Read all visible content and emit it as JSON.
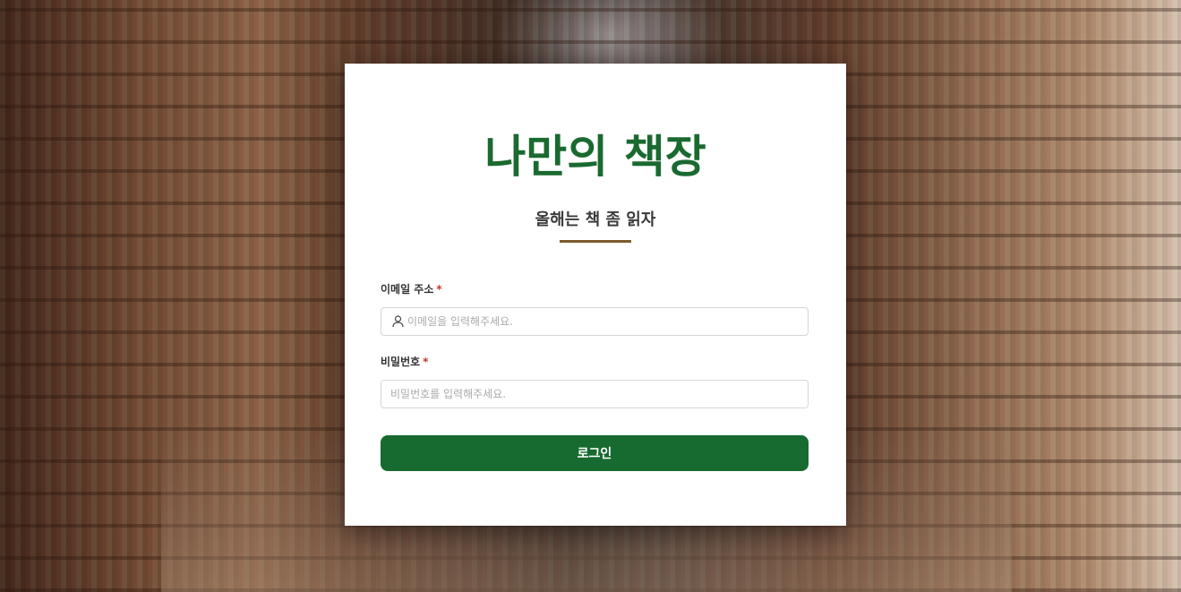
{
  "app": {
    "title": "나만의 책장",
    "subtitle": "올해는 책 좀 읽자"
  },
  "form": {
    "email": {
      "label": "이메일 주소",
      "required_mark": "*",
      "placeholder": "이메일을 입력해주세요.",
      "value": "",
      "icon": "user-icon"
    },
    "password": {
      "label": "비밀번호",
      "required_mark": "*",
      "placeholder": "비밀번호를 입력해주세요.",
      "value": ""
    },
    "submit_label": "로그인"
  },
  "colors": {
    "brand_green": "#176a30",
    "title_green": "#1a6a30",
    "divider_brown": "#7a5c2c",
    "required_red": "#c0392b"
  }
}
